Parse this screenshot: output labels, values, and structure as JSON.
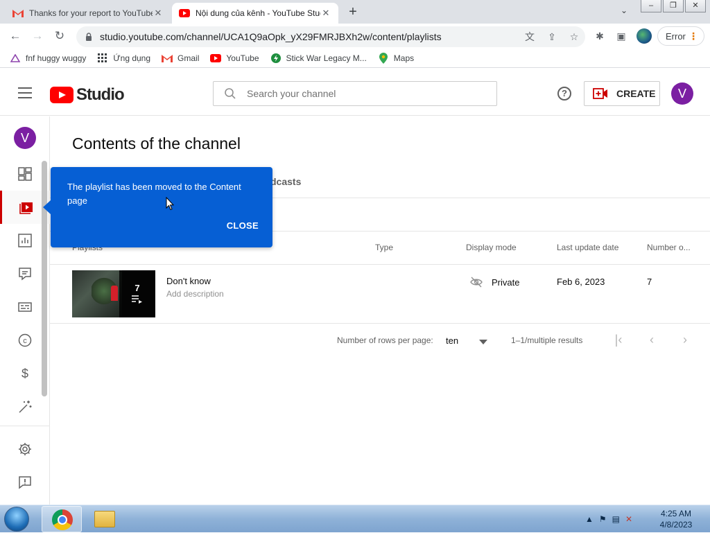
{
  "browser": {
    "tabs": [
      {
        "title": "Thanks for your report to YouTube",
        "favicon": "gmail-icon",
        "active": false
      },
      {
        "title": "Nội dung của kênh - YouTube Studio",
        "favicon": "youtube-icon",
        "active": true
      }
    ],
    "new_tab": "+",
    "url": "studio.youtube.com/channel/UCA1Q9aOpk_yX29FMRJBXh2w/content/playlists",
    "error_label": "Error",
    "bookmarks": [
      {
        "label": "fnf huggy wuggy",
        "icon": "triangle-icon"
      },
      {
        "label": "Ứng dụng",
        "icon": "apps-grid-icon"
      },
      {
        "label": "Gmail",
        "icon": "gmail-icon"
      },
      {
        "label": "YouTube",
        "icon": "youtube-icon"
      },
      {
        "label": "Stick War Legacy M...",
        "icon": "green-bolt-icon"
      },
      {
        "label": "Maps",
        "icon": "maps-pin-icon"
      }
    ]
  },
  "studio": {
    "logo_text": "Studio",
    "search_placeholder": "Search your channel",
    "create_label": "CREATE",
    "avatar_letter": "V",
    "page_title": "Contents of the channel",
    "tab_partial": "dcasts",
    "columns": {
      "playlists": "Playlists",
      "type": "Type",
      "display_mode": "Display mode",
      "last_update": "Last update date",
      "number": "Number o..."
    },
    "playlist": {
      "title": "Don't know",
      "description": "Add description",
      "video_count": "7",
      "visibility": "Private",
      "updated": "Feb 6, 2023",
      "number": "7"
    },
    "pagination": {
      "rows_label": "Number of rows per page:",
      "rows_value": "ten",
      "range": "1–1/multiple results"
    },
    "tooltip": {
      "message": "The playlist has been moved to the Content page",
      "close_label": "CLOSE"
    },
    "colors": {
      "accent": "#065fd4",
      "brand_red": "#ff0000",
      "avatar": "#7b1fa2"
    }
  },
  "taskbar": {
    "time": "4:25 AM",
    "date": "4/8/2023"
  }
}
